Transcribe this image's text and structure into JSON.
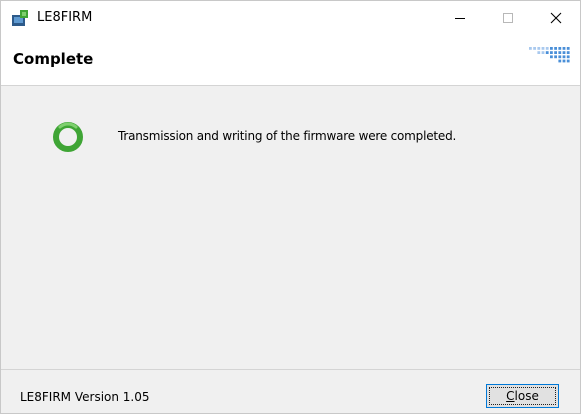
{
  "window": {
    "title": "LE8FIRM",
    "controls": {
      "minimize_icon": "minimize-icon",
      "maximize_icon": "maximize-icon",
      "close_icon": "close-icon"
    }
  },
  "header": {
    "title": "Complete",
    "logo_icon": "dot-grid-logo",
    "logo_color": "#4a8fd8"
  },
  "main": {
    "status_icon": "success-ring-icon",
    "status_color": "#3fa535",
    "message": "Transmission and writing of the firmware were completed."
  },
  "footer": {
    "version": "LE8FIRM Version 1.05",
    "close_button": {
      "mnemonic": "C",
      "rest": "lose"
    }
  },
  "colors": {
    "accent": "#0078d7",
    "window_bg": "#f0f0f0"
  }
}
